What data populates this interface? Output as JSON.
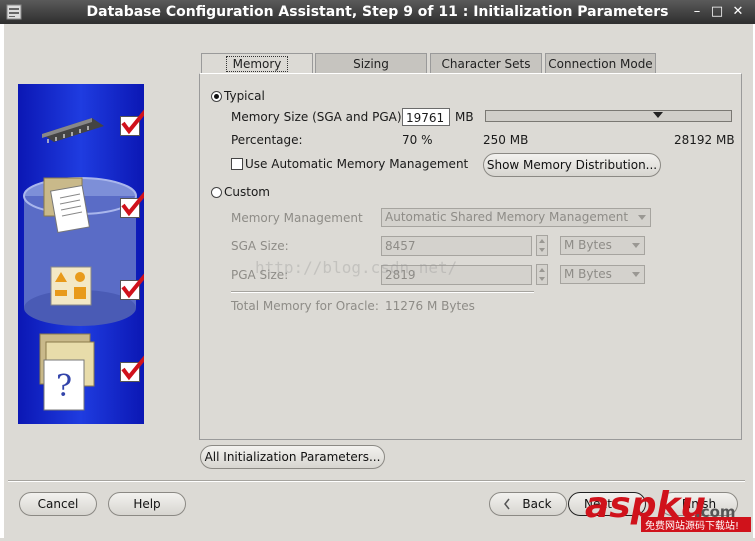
{
  "window": {
    "title": "Database Configuration Assistant, Step 9 of 11 : Initialization Parameters",
    "minimize_glyph": "–",
    "maximize_glyph": "□",
    "close_glyph": "✕"
  },
  "tabs": [
    {
      "label": "Memory",
      "active": true
    },
    {
      "label": "Sizing",
      "active": false
    },
    {
      "label": "Character Sets",
      "active": false
    },
    {
      "label": "Connection Mode",
      "active": false
    }
  ],
  "typical": {
    "label": "Typical",
    "selected": true,
    "memory_size_label": "Memory Size (SGA and PGA):",
    "memory_size_value": "19761",
    "memory_size_unit": "MB",
    "percentage_label": "Percentage:",
    "percentage_value": "70 %",
    "slider_min_label": "250 MB",
    "slider_max_label": "28192 MB",
    "slider_level_percent": 70,
    "amm_label": "Use Automatic Memory Management",
    "amm_checked": false,
    "show_distribution_label": "Show Memory Distribution..."
  },
  "custom": {
    "label": "Custom",
    "selected": false,
    "memory_management_label": "Memory Management",
    "memory_management_value": "Automatic Shared Memory Management",
    "sga_label": "SGA Size:",
    "sga_value": "8457",
    "sga_unit": "M Bytes",
    "pga_label": "PGA Size:",
    "pga_value": "2819",
    "pga_unit": "M Bytes",
    "total_label": "Total Memory for Oracle:",
    "total_value": "11276 M Bytes"
  },
  "all_params_label": "All Initialization Parameters...",
  "footer": {
    "cancel_label": "Cancel",
    "help_label": "Help",
    "back_label": "Back",
    "next_label": "Next",
    "finish_label": "Finish"
  },
  "overlays": {
    "watermark": "http://blog.csdn.net/",
    "logo_text": "aspku",
    "logo_suffix": ".com",
    "logo_caption": "免费网站源码下载站!"
  },
  "colors": {
    "illustration_blue": "#1f3ce0",
    "check_red": "#d0121b"
  }
}
